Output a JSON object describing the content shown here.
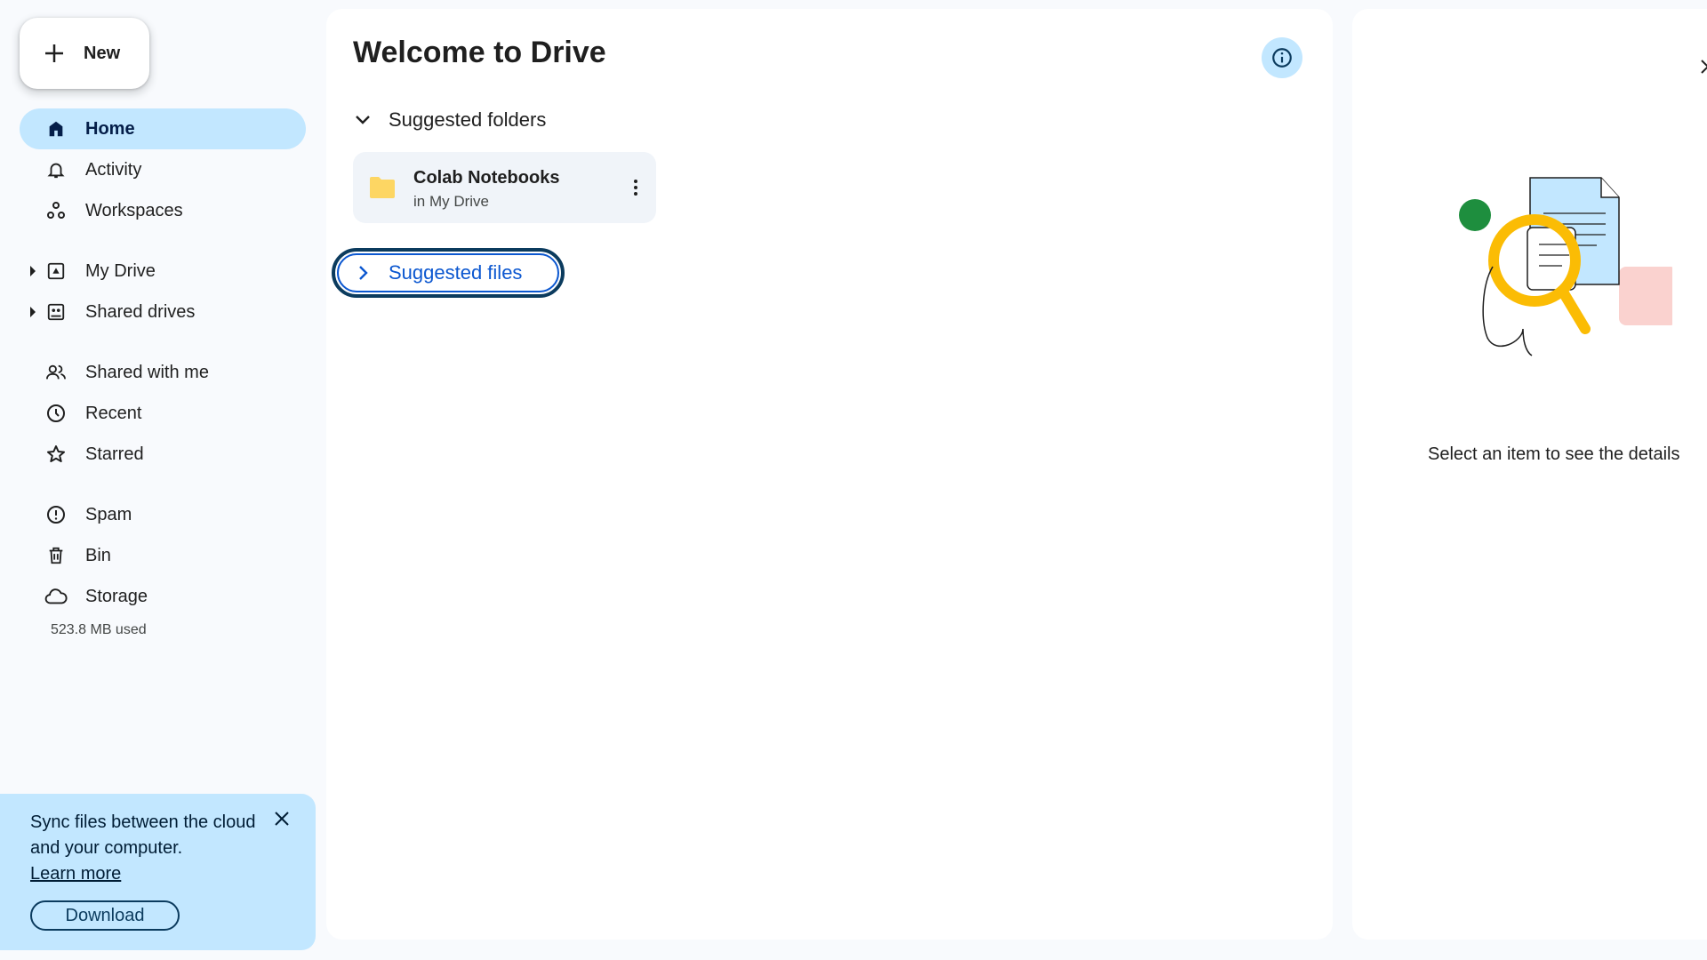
{
  "sidebar": {
    "new_label": "New",
    "items": [
      {
        "label": "Home",
        "icon": "home-icon"
      },
      {
        "label": "Activity",
        "icon": "bell-icon"
      },
      {
        "label": "Workspaces",
        "icon": "workspaces-icon"
      },
      {
        "label": "My Drive",
        "icon": "my-drive-icon"
      },
      {
        "label": "Shared drives",
        "icon": "shared-drives-icon"
      },
      {
        "label": "Shared with me",
        "icon": "people-icon"
      },
      {
        "label": "Recent",
        "icon": "clock-icon"
      },
      {
        "label": "Starred",
        "icon": "star-icon"
      },
      {
        "label": "Spam",
        "icon": "spam-icon"
      },
      {
        "label": "Bin",
        "icon": "trash-icon"
      },
      {
        "label": "Storage",
        "icon": "cloud-icon"
      }
    ],
    "storage_used": "523.8 MB used"
  },
  "sync_card": {
    "text": "Sync files between the cloud and your computer.",
    "link": "Learn more",
    "button": "Download"
  },
  "main": {
    "title": "Welcome to Drive",
    "suggested_folders_label": "Suggested folders",
    "folders": [
      {
        "name": "Colab Notebooks",
        "location": "in My Drive"
      }
    ],
    "suggested_files_label": "Suggested files"
  },
  "details": {
    "message": "Select an item to see the details"
  },
  "colors": {
    "accent": "#c2e7ff",
    "link": "#0b57d0",
    "folder": "#fdd663",
    "focus_ring": "#0b3b5e"
  }
}
